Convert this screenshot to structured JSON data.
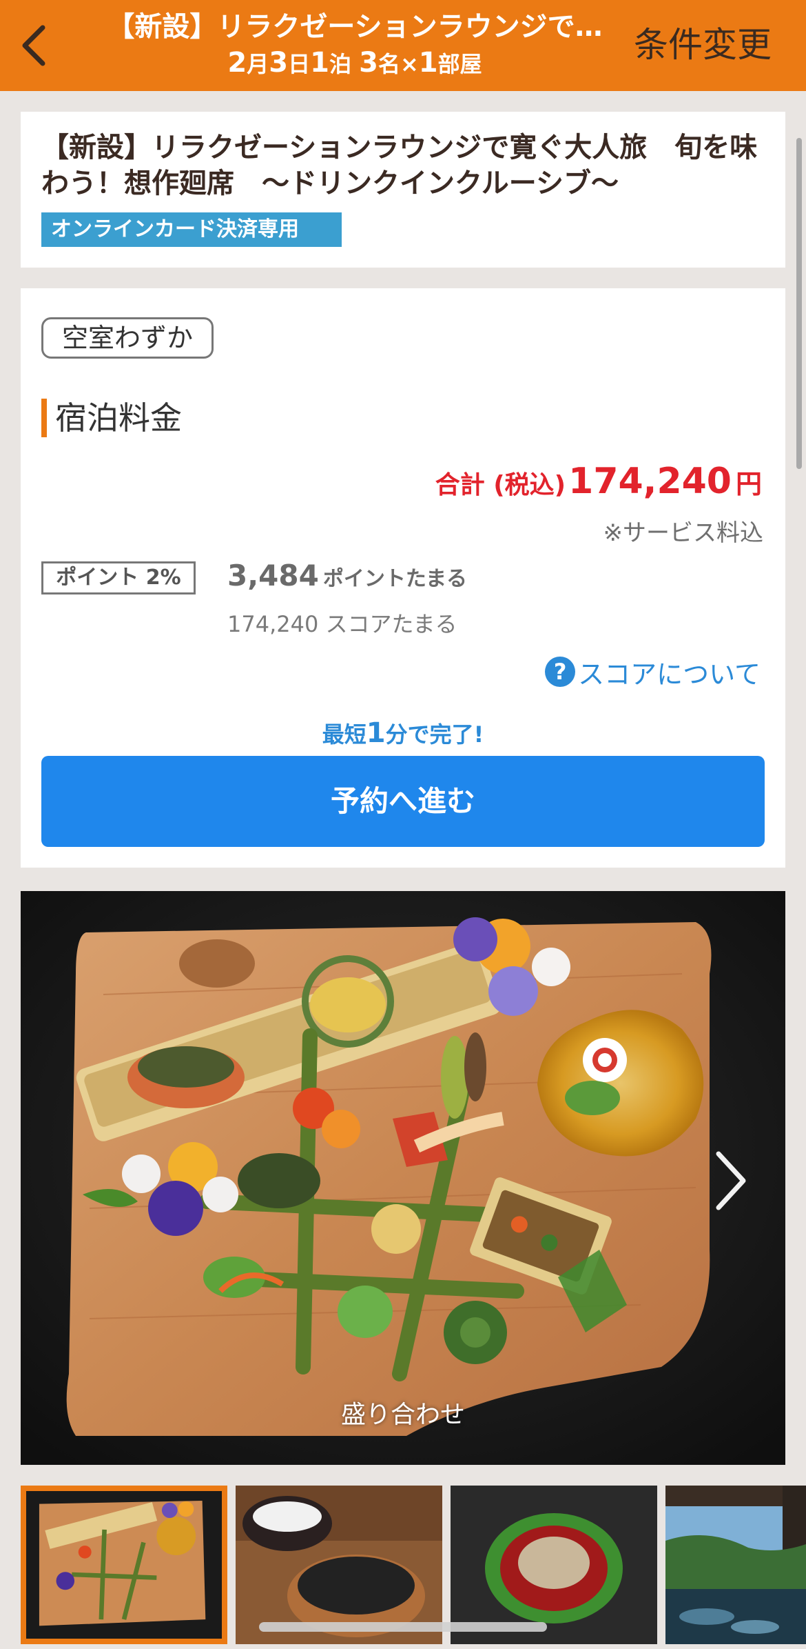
{
  "header": {
    "title": "【新設】リラクゼーションラウンジで…",
    "month": "2",
    "month_unit": "月",
    "day": "3",
    "day_unit": "日",
    "nights": "1",
    "nights_unit": "泊",
    "guests": "3",
    "guests_unit": "名×",
    "rooms": "1",
    "rooms_unit": "部屋",
    "change_label": "条件変更"
  },
  "plan": {
    "name": "【新設】リラクゼーションラウンジで寛ぐ大人旅　旬を味わう！想作廻席　～ドリンクインクルーシブ～",
    "payment_badge": "オンラインカード決済専用"
  },
  "price": {
    "vacancy": "空室わずか",
    "heading": "宿泊料金",
    "total_label": "合計 (税込)",
    "total_value": "174,240",
    "total_unit": "円",
    "service_note": "※サービス料込",
    "point_badge": "ポイント 2%",
    "points_value": "3,484",
    "points_unit": "ポイントたまる",
    "score_text": "174,240 スコアたまる",
    "score_link": "スコアについて",
    "help_glyph": "?",
    "quick_prefix": "最短",
    "quick_num": "1",
    "quick_suffix": "分で完了!",
    "reserve_label": "予約へ進む"
  },
  "gallery": {
    "caption": "盛り合わせ"
  },
  "colors": {
    "brand_orange": "#eb7a14",
    "price_red": "#e2232c",
    "link_blue": "#2b8ad7",
    "button_blue": "#1f87ec",
    "badge_blue": "#3b9fd0"
  }
}
